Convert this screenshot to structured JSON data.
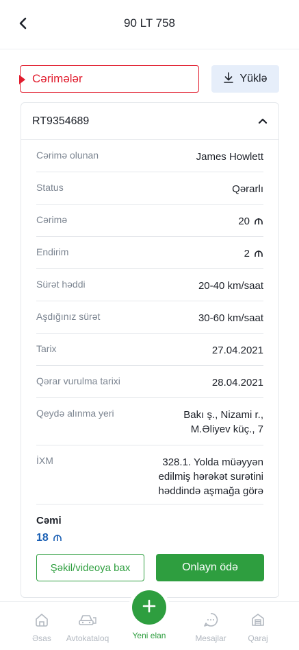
{
  "header": {
    "title": "90 LT 758"
  },
  "section": {
    "label": "Cərimələr",
    "download_label": "Yüklə"
  },
  "fine": {
    "id": "RT9354689",
    "rows": [
      {
        "key": "Cərimə olunan",
        "value": "James Howlett"
      },
      {
        "key": "Status",
        "value": "Qərarlı"
      },
      {
        "key": "Cərimə",
        "value": "20"
      },
      {
        "key": "Endirim",
        "value": "2"
      },
      {
        "key": "Sürət həddi",
        "value": "20-40 km/saat"
      },
      {
        "key": "Aşdığınız sürət",
        "value": "30-60 km/saat"
      },
      {
        "key": "Tarix",
        "value": "27.04.2021"
      },
      {
        "key": "Qərar vurulma tarixi",
        "value": "28.04.2021"
      },
      {
        "key": "Qeydə alınma yeri",
        "value_lines": [
          "Bakı ş., Nizami r.,",
          "M.Əliyev küç., 7"
        ]
      },
      {
        "key": "İXM",
        "value_lines": [
          "328.1. Yolda müəyyən",
          "edilmiş hərəkət surətini",
          "həddində aşmağa görə"
        ]
      }
    ],
    "total_label": "Cəmi",
    "total_value": "18",
    "media_button": "Şəkil/videoya bax",
    "pay_button": "Onlayn ödə"
  },
  "tabbar": {
    "items": [
      {
        "label": "Əsas",
        "icon": "home-icon"
      },
      {
        "label": "Avtokataloq",
        "icon": "car-icon"
      },
      {
        "label": "Yeni elan",
        "icon": "plus-icon"
      },
      {
        "label": "Mesajlar",
        "icon": "message-icon"
      },
      {
        "label": "Qaraj",
        "icon": "garage-icon"
      }
    ]
  },
  "colors": {
    "accent_green": "#2e9e3f",
    "alert_red": "#e11d2e",
    "link_blue": "#1a5fb4"
  }
}
